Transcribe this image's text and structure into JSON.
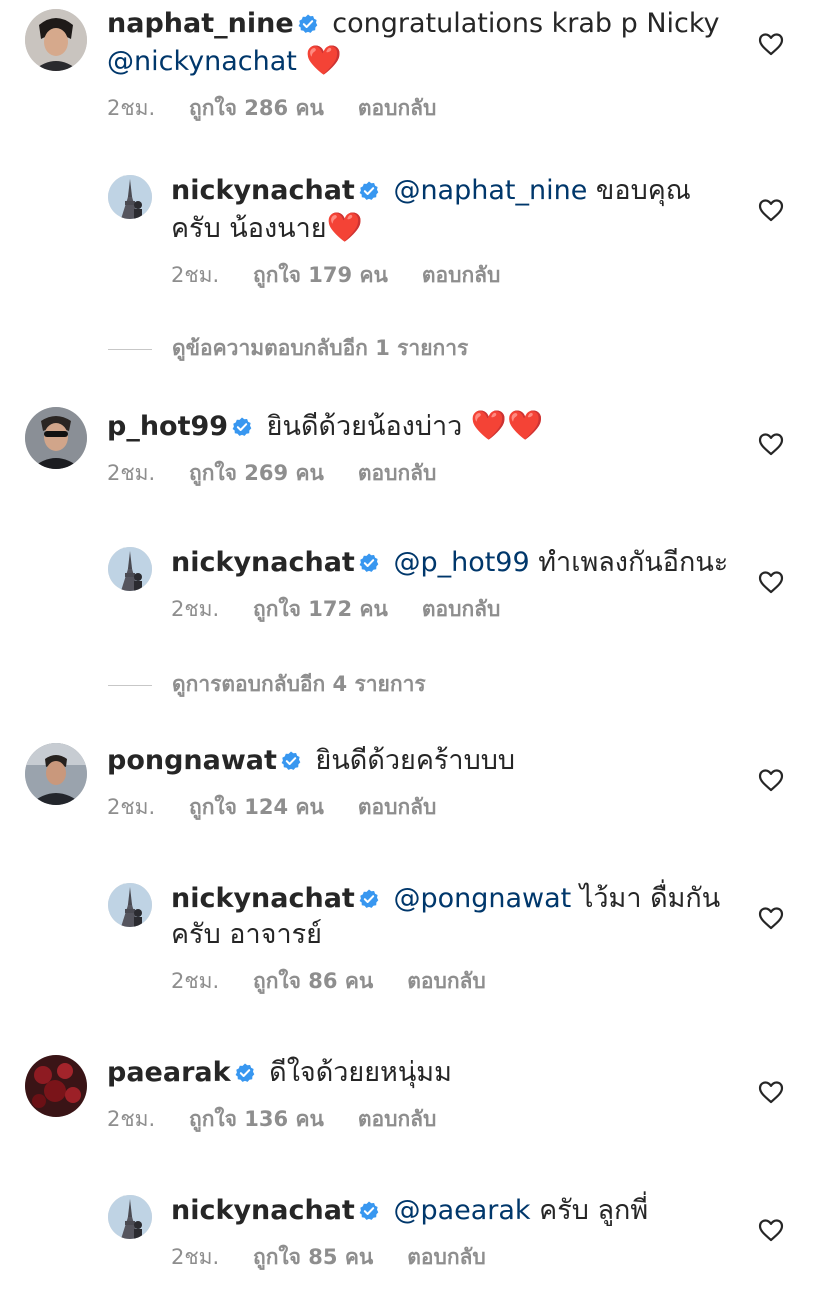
{
  "comments": [
    {
      "username": "naphat_nine",
      "text": "congratulations krab p Nicky",
      "mention": "@nickynachat",
      "emoji": "❤️",
      "time": "2ชม.",
      "likes": "ถูกใจ 286 คน",
      "reply_label": "ตอบกลับ",
      "replies": [
        {
          "username": "nickynachat",
          "mention": "@naphat_nine",
          "text": "ขอบคุณครับ น้องนาย",
          "emoji": "❤️",
          "time": "2ชม.",
          "likes": "ถูกใจ 179 คน",
          "reply_label": "ตอบกลับ"
        }
      ],
      "view_more": "ดูข้อความตอบกลับอีก 1 รายการ"
    },
    {
      "username": "p_hot99",
      "text": "ยินดีด้วยน้องบ่าว",
      "emoji": "❤️❤️",
      "time": "2ชม.",
      "likes": "ถูกใจ 269 คน",
      "reply_label": "ตอบกลับ",
      "replies": [
        {
          "username": "nickynachat",
          "mention": "@p_hot99",
          "text": "ทำเพลงกันอีกนะ",
          "time": "2ชม.",
          "likes": "ถูกใจ 172 คน",
          "reply_label": "ตอบกลับ"
        }
      ],
      "view_more": "ดูการตอบกลับอีก 4 รายการ"
    },
    {
      "username": "pongnawat",
      "text": "ยินดีด้วยคร้าบบบ",
      "time": "2ชม.",
      "likes": "ถูกใจ 124 คน",
      "reply_label": "ตอบกลับ",
      "replies": [
        {
          "username": "nickynachat",
          "mention": "@pongnawat",
          "text": "ไว้มา ดื่มกัน ครับ อาจารย์",
          "time": "2ชม.",
          "likes": "ถูกใจ 86 คน",
          "reply_label": "ตอบกลับ"
        }
      ]
    },
    {
      "username": "paearak",
      "text": "ดีใจด้วยยหนุ่มม",
      "time": "2ชม.",
      "likes": "ถูกใจ 136 คน",
      "reply_label": "ตอบกลับ",
      "replies": [
        {
          "username": "nickynachat",
          "mention": "@paearak",
          "text": "ครับ ลูกพี่",
          "time": "2ชม.",
          "likes": "ถูกใจ 85 คน",
          "reply_label": "ตอบกลับ"
        }
      ]
    }
  ],
  "icons": {
    "verified": "verified-badge-icon",
    "like": "heart-outline-icon"
  },
  "colors": {
    "text": "#262626",
    "secondary": "#8e8e8e",
    "mention": "#00376b",
    "verified": "#3897f0",
    "heart_emoji": "#e0182d"
  }
}
